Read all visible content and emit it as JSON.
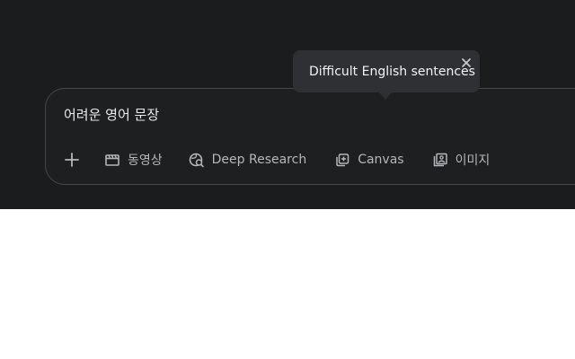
{
  "prompt": {
    "text": "어려운 영어 문장"
  },
  "toolbar": {
    "add_icon": "plus-icon",
    "items": [
      {
        "label": "동영상",
        "icon": "video-clapper-icon"
      },
      {
        "label": "Deep Research",
        "icon": "deep-research-icon"
      },
      {
        "label": "Canvas",
        "icon": "canvas-icon"
      },
      {
        "label": "이미지",
        "icon": "image-icon"
      }
    ]
  },
  "tooltip": {
    "text": "Difficult English sentences",
    "close_icon": "close-icon"
  },
  "colors": {
    "background": "#1b1c1e",
    "tooltip_bg": "#2f3033",
    "text": "#e8eaed",
    "muted": "#b4b7bb",
    "border": "#46484c"
  }
}
